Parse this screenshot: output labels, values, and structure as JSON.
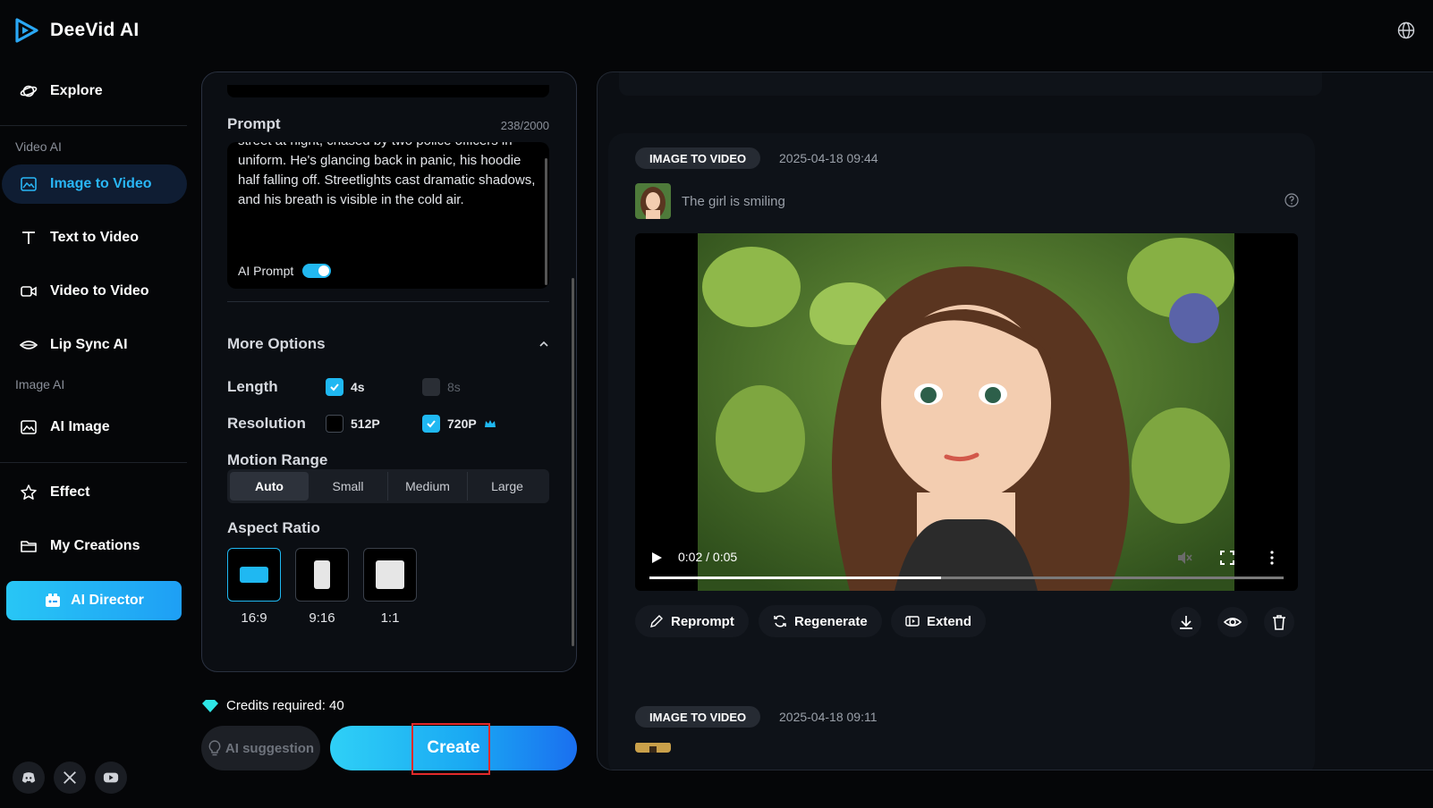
{
  "app": {
    "name": "DeeVid AI"
  },
  "sidebar": {
    "explore": "Explore",
    "group_video": "Video AI",
    "image_to_video": "Image to Video",
    "text_to_video": "Text to Video",
    "video_to_video": "Video to Video",
    "lip_sync": "Lip Sync AI",
    "group_image": "Image AI",
    "ai_image": "AI Image",
    "effect": "Effect",
    "my_creations": "My Creations",
    "ai_director": "AI Director"
  },
  "settings": {
    "prompt_label": "Prompt",
    "prompt_counter": "238/2000",
    "prompt_text": "A young man in a grey hoodie sprinting through a street at night, chased by two police officers in uniform. He's glancing back in panic, his hoodie half falling off. Streetlights cast dramatic shadows, and his breath is visible in the cold air.",
    "ai_prompt_label": "AI Prompt",
    "more_options": "More Options",
    "length_label": "Length",
    "length_options": [
      "4s",
      "8s"
    ],
    "resolution_label": "Resolution",
    "resolution_options": [
      "512P",
      "720P"
    ],
    "motion_label": "Motion Range",
    "motion_options": [
      "Auto",
      "Small",
      "Medium",
      "Large"
    ],
    "aspect_label": "Aspect Ratio",
    "aspect_options": [
      "16:9",
      "9:16",
      "1:1"
    ],
    "credits": "Credits required: 40",
    "suggestion": "AI suggestion",
    "create": "Create"
  },
  "results": {
    "item1": {
      "badge": "IMAGE TO VIDEO",
      "datetime": "2025-04-18 09:44",
      "caption": "The girl is smiling",
      "time": "0:02 / 0:05",
      "progress": 0.46,
      "actions": [
        "Reprompt",
        "Regenerate",
        "Extend"
      ]
    },
    "item2": {
      "badge": "IMAGE TO VIDEO",
      "datetime": "2025-04-18 09:11"
    }
  },
  "colors": {
    "accent": "#1fb8f2",
    "background": "#050608",
    "panel": "#0b0e13"
  }
}
